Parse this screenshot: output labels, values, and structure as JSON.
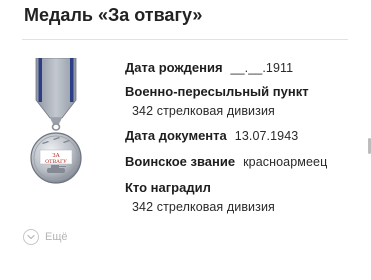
{
  "header": {
    "title": "Медаль «За отвагу»"
  },
  "medal": {
    "inscription_line1": "ЗА",
    "inscription_line2": "ОТВАГУ"
  },
  "details": {
    "birth_date_label": "Дата рождения",
    "birth_date_value": "__.__.1911",
    "transit_point_label": "Военно-пересыльный пункт",
    "transit_point_value": "342 стрелковая дивизия",
    "document_date_label": "Дата документа",
    "document_date_value": "13.07.1943",
    "rank_label": "Воинское звание",
    "rank_value": "красноармеец",
    "awarded_by_label": "Кто наградил",
    "awarded_by_value": "342 стрелковая дивизия"
  },
  "more": {
    "label": "Ещё",
    "icon": "chevron-down-icon"
  },
  "colors": {
    "text": "#1e1e1e",
    "muted": "#b5b5b5",
    "ribbon_grey": "#a9b0bb",
    "ribbon_blue": "#2c3f86",
    "medal_silver": "#c8ccd2"
  }
}
